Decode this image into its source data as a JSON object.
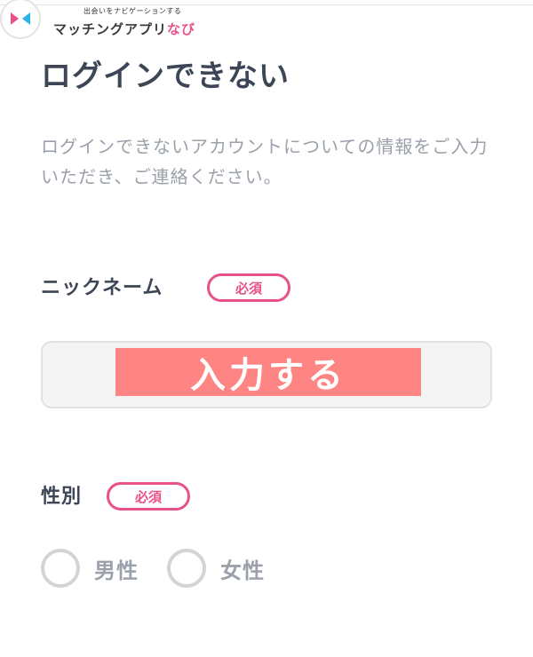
{
  "header": {
    "tagline": "出会いをナビゲーションする",
    "brand_main": "マッチングアプリ",
    "brand_accent": "なび"
  },
  "title": "ログインできない",
  "description": "ログインできないアカウントについての情報をご入力いただき、ご連絡ください。",
  "nickname": {
    "label": "ニックネーム",
    "badge": "必須",
    "overlay_text": "入力する"
  },
  "gender": {
    "label": "性別",
    "badge": "必須",
    "options": [
      "男性",
      "女性"
    ]
  },
  "colors": {
    "accent": "#e8518a",
    "overlay": "#ff8584",
    "text_dark": "#3d4656",
    "text_muted": "#9aa1ab"
  }
}
